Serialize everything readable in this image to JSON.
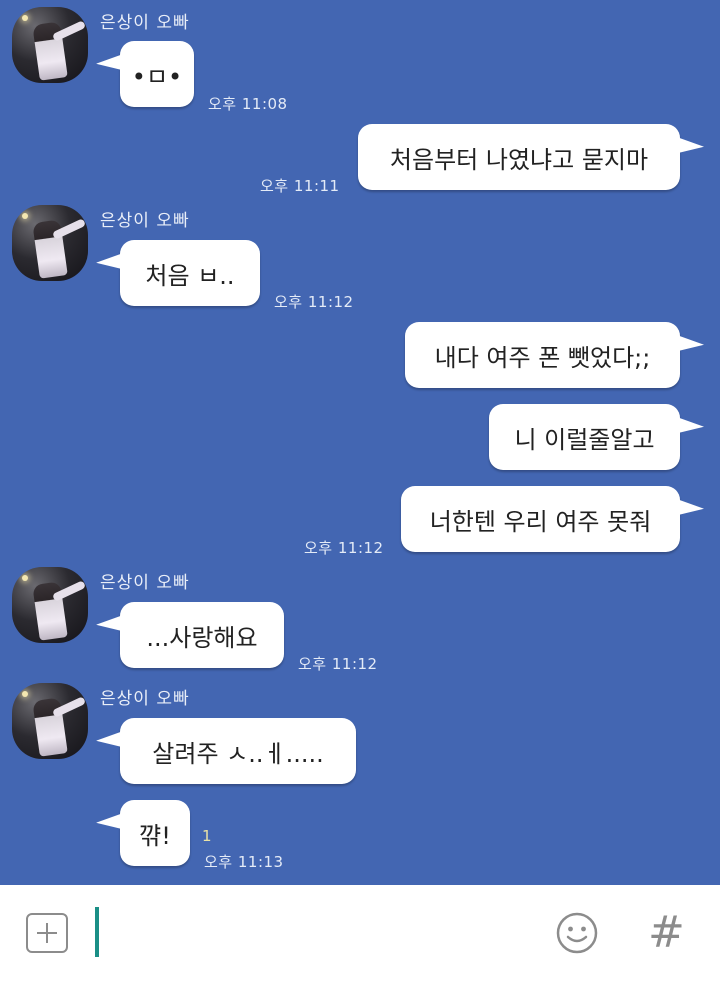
{
  "chat": {
    "messages": [
      {
        "sender": "은상이 오빠",
        "direction": "in",
        "text": "•ㅁ•",
        "time": "오후 11:08"
      },
      {
        "direction": "out",
        "text": "처음부터 나였냐고 묻지마",
        "time": "오후 11:11"
      },
      {
        "sender": "은상이 오빠",
        "direction": "in",
        "text": "처음 ㅂ..",
        "time": "오후 11:12"
      },
      {
        "direction": "out",
        "text": "내다 여주 폰 뺏었다;;"
      },
      {
        "direction": "out",
        "text": "니 이럴줄알고"
      },
      {
        "direction": "out",
        "text": "너한텐 우리 여주 못줘",
        "time": "오후 11:12"
      },
      {
        "sender": "은상이 오빠",
        "direction": "in",
        "text": "...사랑해요",
        "time": "오후 11:12"
      },
      {
        "sender": "은상이 오빠",
        "direction": "in",
        "text": "살려주 ㅅ..ㅔ....."
      },
      {
        "direction": "in",
        "text": "꺆!",
        "time": "오후 11:13",
        "unread": "1"
      }
    ]
  },
  "composer": {
    "input_value": "",
    "plus_icon": "plus-square-icon",
    "emoji_icon": "smiley-icon",
    "hash_icon": "hash-icon",
    "hash_glyph": "#"
  },
  "colors": {
    "chat_background": "#4366b2",
    "bubble": "#ffffff",
    "cursor": "#1a8f86"
  }
}
